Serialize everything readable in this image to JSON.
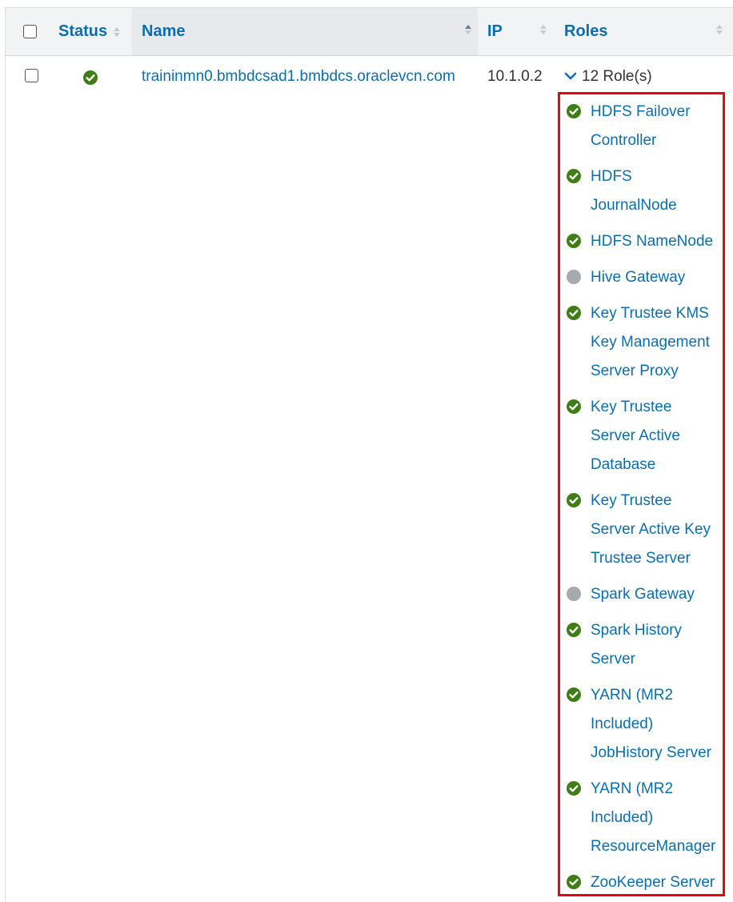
{
  "table": {
    "columns": {
      "status": "Status",
      "name": "Name",
      "ip": "IP",
      "roles": "Roles"
    },
    "rows": [
      {
        "status": "good",
        "name": "traininmn0.bmbdcsad1.bmbdcs.oraclevcn.com",
        "ip": "10.1.0.2",
        "roles_count": "12 Role(s)",
        "roles": [
          {
            "label": "HDFS Failover Controller",
            "status": "good"
          },
          {
            "label": "HDFS JournalNode",
            "status": "good"
          },
          {
            "label": "HDFS NameNode",
            "status": "good"
          },
          {
            "label": "Hive Gateway",
            "status": "none"
          },
          {
            "label": "Key Trustee KMS Key Management Server Proxy",
            "status": "good"
          },
          {
            "label": "Key Trustee Server Active Database",
            "status": "good"
          },
          {
            "label": "Key Trustee Server Active Key Trustee Server",
            "status": "good"
          },
          {
            "label": "Spark Gateway",
            "status": "none"
          },
          {
            "label": "Spark History Server",
            "status": "good"
          },
          {
            "label": "YARN (MR2 Included) JobHistory Server",
            "status": "good"
          },
          {
            "label": "YARN (MR2 Included) ResourceManager",
            "status": "good"
          },
          {
            "label": "ZooKeeper Server",
            "status": "good"
          }
        ]
      }
    ]
  },
  "colors": {
    "link": "#0a6eae",
    "good": "#3f7d17",
    "none": "#a6a9ad",
    "highlight_border": "#e8070e"
  }
}
